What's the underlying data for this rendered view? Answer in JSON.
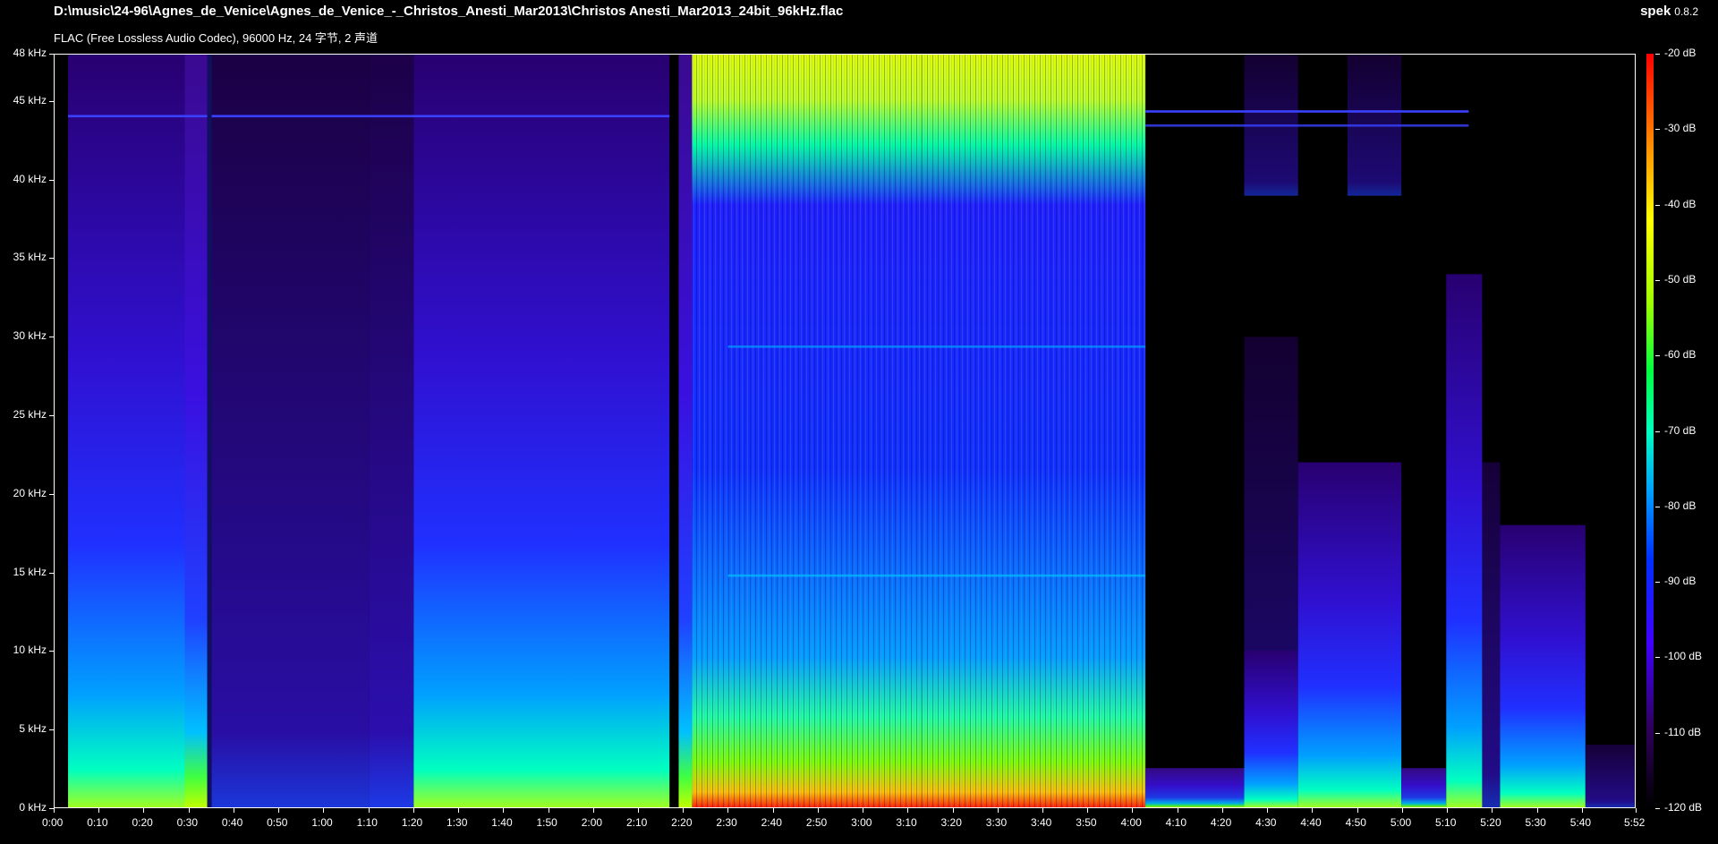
{
  "header": {
    "file_path": "D:\\music\\24-96\\Agnes_de_Venice\\Agnes_de_Venice_-_Christos_Anesti_Mar2013\\Christos Anesti_Mar2013_24bit_96kHz.flac",
    "file_info": "FLAC (Free Lossless Audio Codec), 96000 Hz, 24 字节, 2 声道",
    "app_name": "spek",
    "app_version": "0.8.2"
  },
  "y_axis": {
    "ticks": [
      "48 kHz",
      "45 kHz",
      "40 kHz",
      "35 kHz",
      "30 kHz",
      "25 kHz",
      "20 kHz",
      "15 kHz",
      "10 kHz",
      "5 kHz",
      "0 kHz"
    ],
    "values_khz": [
      48,
      45,
      40,
      35,
      30,
      25,
      20,
      15,
      10,
      5,
      0
    ],
    "max_khz": 48
  },
  "x_axis": {
    "ticks": [
      "0:00",
      "0:10",
      "0:20",
      "0:30",
      "0:40",
      "0:50",
      "1:00",
      "1:10",
      "1:20",
      "1:30",
      "1:40",
      "1:50",
      "2:00",
      "2:10",
      "2:20",
      "2:30",
      "2:40",
      "2:50",
      "3:00",
      "3:10",
      "3:20",
      "3:30",
      "3:40",
      "3:50",
      "4:00",
      "4:10",
      "4:20",
      "4:30",
      "4:40",
      "4:50",
      "5:00",
      "5:10",
      "5:20",
      "5:30",
      "5:40",
      "5:52"
    ],
    "values_sec": [
      0,
      10,
      20,
      30,
      40,
      50,
      60,
      70,
      80,
      90,
      100,
      110,
      120,
      130,
      140,
      150,
      160,
      170,
      180,
      190,
      200,
      210,
      220,
      230,
      240,
      250,
      260,
      270,
      280,
      290,
      300,
      310,
      320,
      330,
      340,
      352
    ],
    "duration_sec": 352
  },
  "db_scale": {
    "ticks": [
      "-20 dB",
      "-30 dB",
      "-40 dB",
      "-50 dB",
      "-60 dB",
      "-70 dB",
      "-80 dB",
      "-90 dB",
      "-100 dB",
      "-110 dB",
      "-120 dB"
    ],
    "values_db": [
      -20,
      -30,
      -40,
      -50,
      -60,
      -70,
      -80,
      -90,
      -100,
      -110,
      -120
    ],
    "max_db": -20,
    "min_db": -120
  },
  "colors": {
    "background": "#000000",
    "text": "#ffffff",
    "palette": [
      "#000000",
      "#2a0060",
      "#3a00ff",
      "#0040ff",
      "#00a0ff",
      "#00ffc0",
      "#40ff40",
      "#c0ff00",
      "#ffff00",
      "#ff8000",
      "#ff0000"
    ]
  }
}
